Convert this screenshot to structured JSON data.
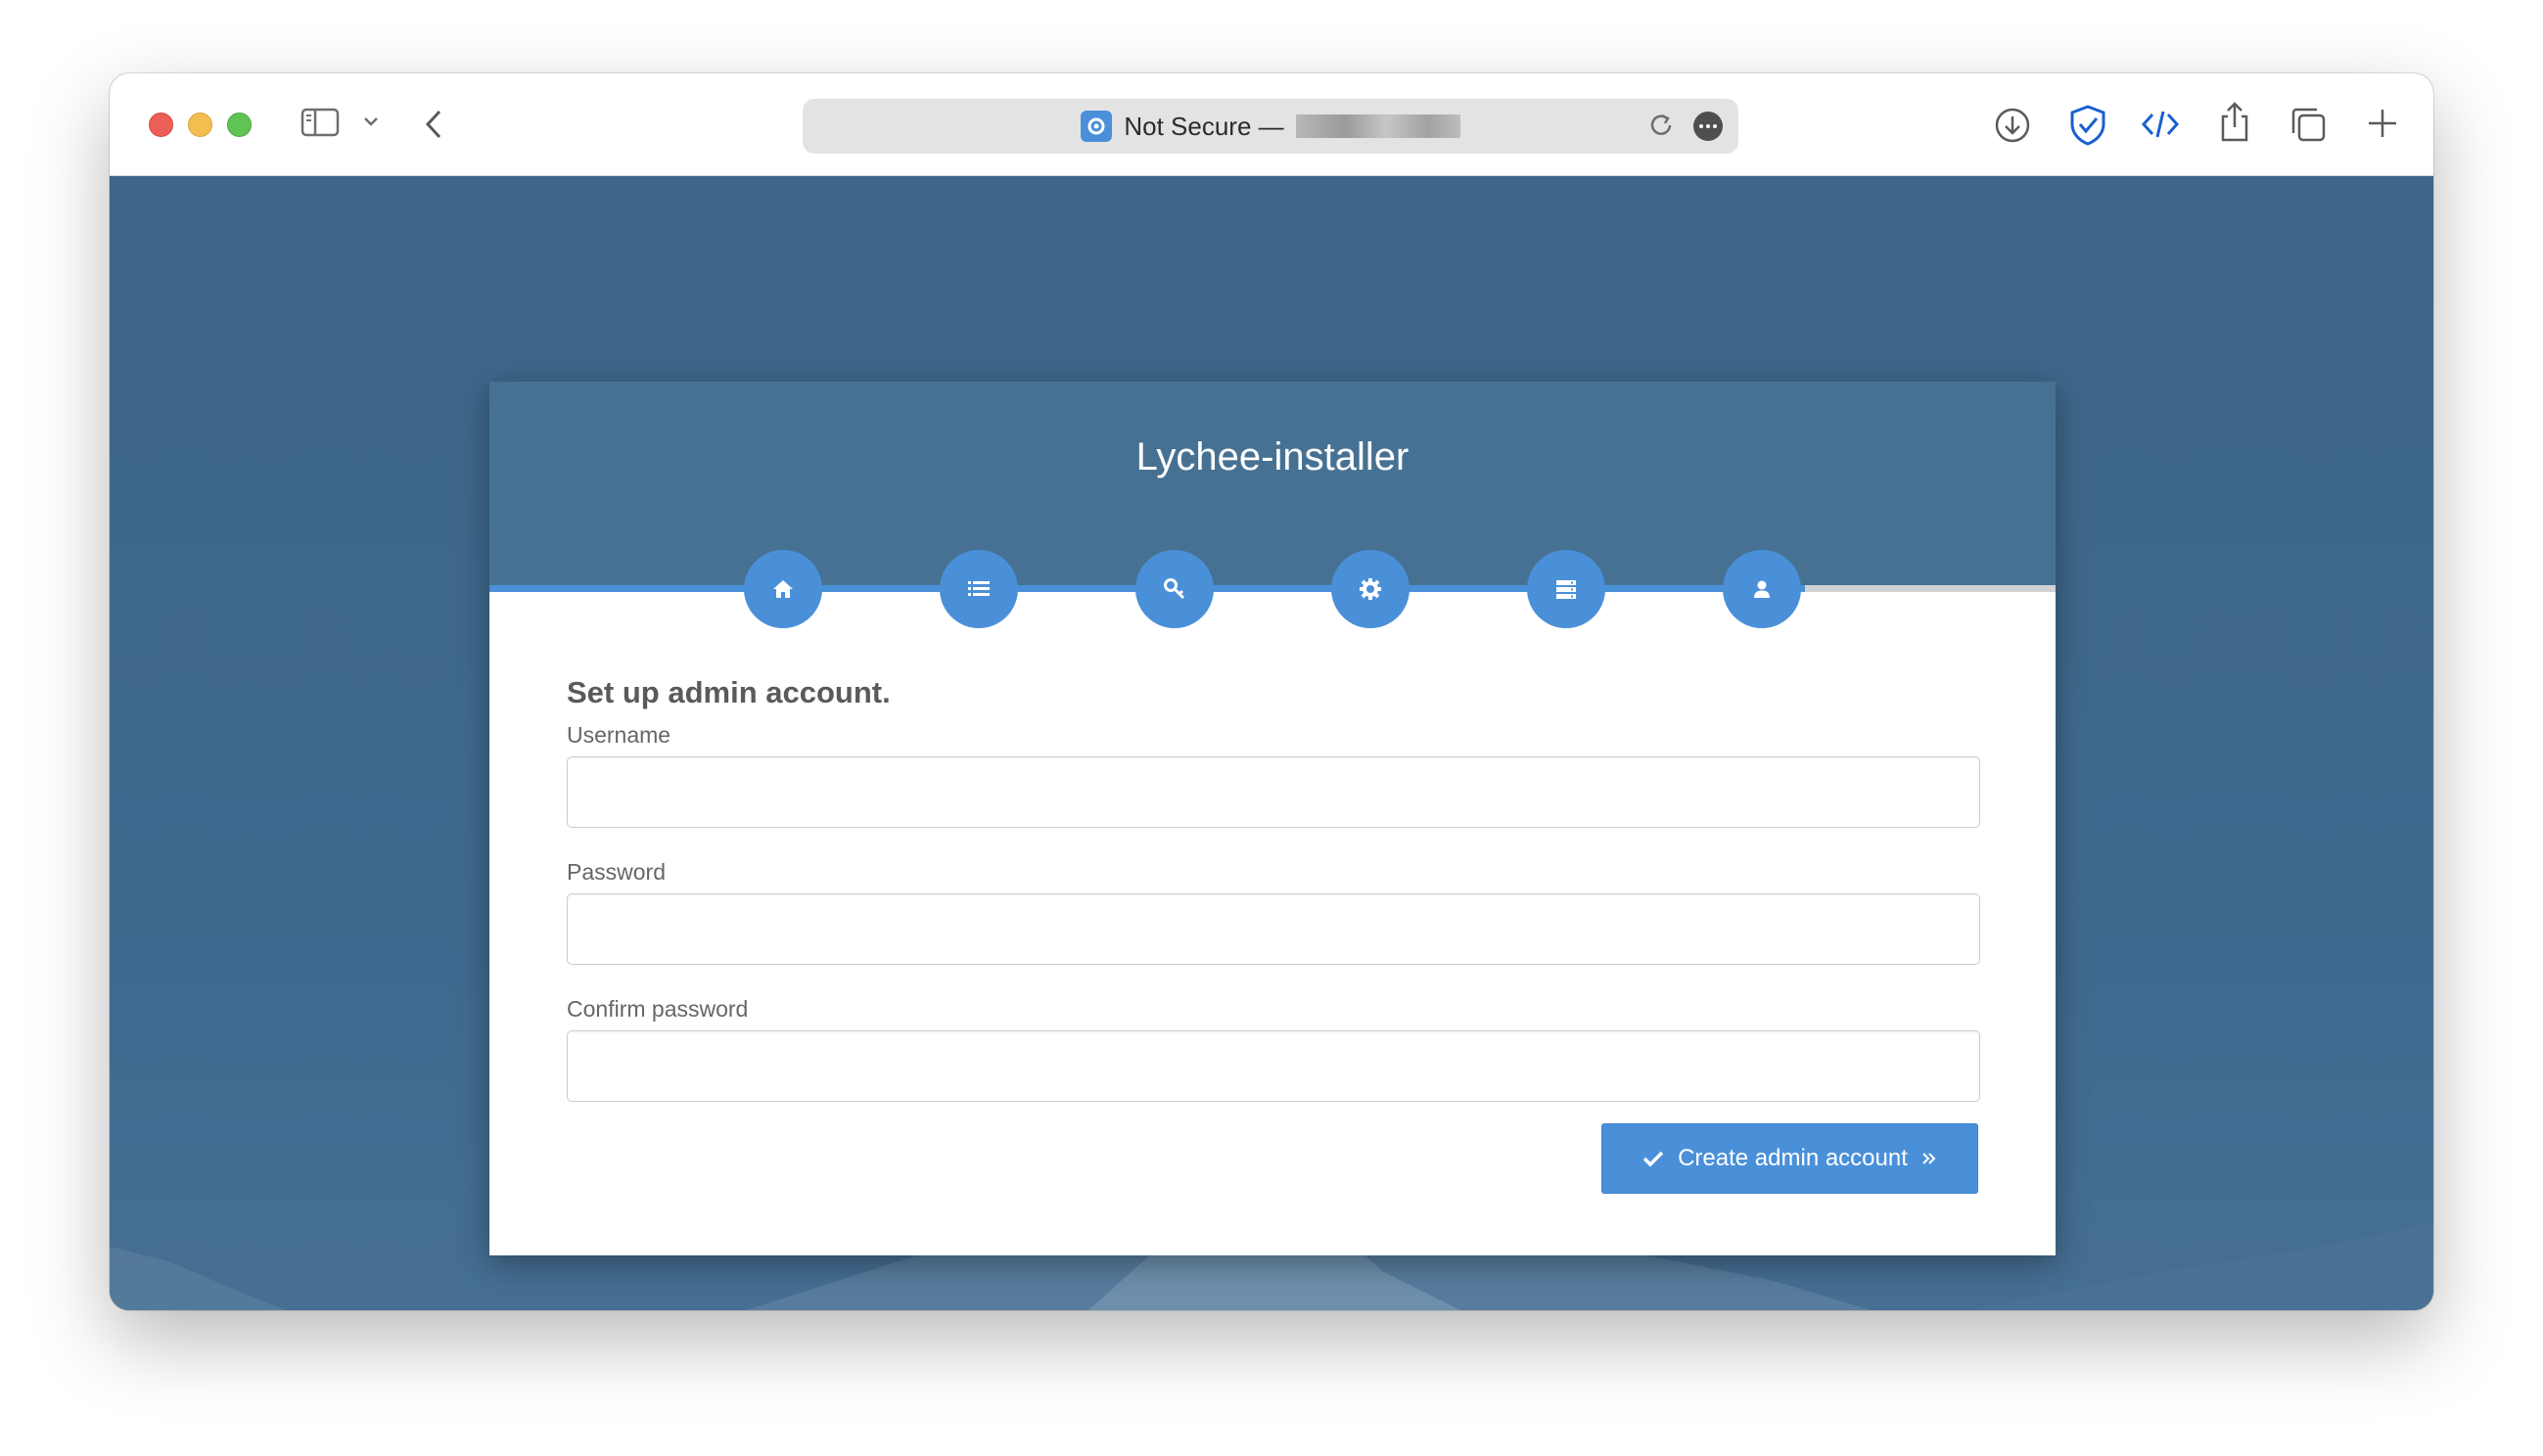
{
  "browser": {
    "address_prefix": "Not Secure —",
    "icons": [
      "sidebar-icon",
      "chevron-down-icon",
      "back-icon",
      "reload-icon",
      "more-icon",
      "download-icon",
      "shield-icon",
      "code-icon",
      "share-icon",
      "tabs-icon",
      "new-tab-icon"
    ]
  },
  "installer": {
    "title": "Lychee-installer",
    "steps": [
      {
        "icon": "home-icon"
      },
      {
        "icon": "list-icon"
      },
      {
        "icon": "key-icon"
      },
      {
        "icon": "gear-icon"
      },
      {
        "icon": "server-icon"
      },
      {
        "icon": "user-icon"
      }
    ],
    "progress": 0.84,
    "accent_color": "#4a90d9",
    "header_color": "#467193"
  },
  "form": {
    "heading": "Set up admin account.",
    "username_label": "Username",
    "username_value": "",
    "password_label": "Password",
    "password_value": "",
    "confirm_label": "Confirm password",
    "confirm_value": "",
    "submit_label": "Create admin account"
  }
}
